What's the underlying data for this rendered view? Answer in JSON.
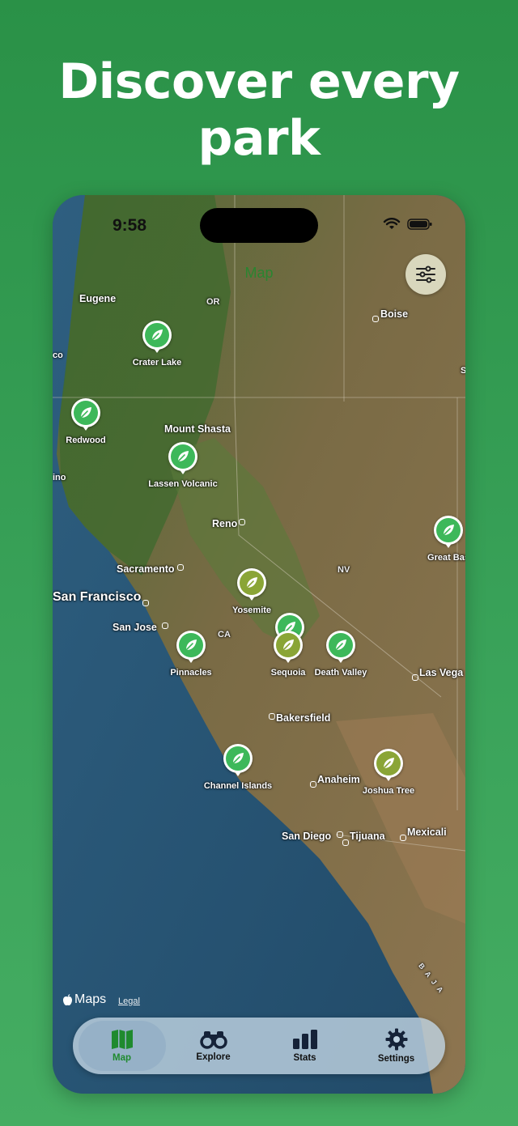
{
  "headline": "Discover every park",
  "status_bar": {
    "time": "9:58"
  },
  "nav": {
    "title": "Map",
    "filter_icon": "sliders-icon"
  },
  "map": {
    "attribution": "Maps",
    "legal": "Legal",
    "places": {
      "eugene": "Eugene",
      "or": "OR",
      "boise": "Boise",
      "co": "co",
      "mount_shasta": "Mount Shasta",
      "ino": "ino",
      "reno": "Reno",
      "sacramento": "Sacramento",
      "nv": "NV",
      "san_francisco": "San Francisco",
      "san_jose": "San Jose",
      "ca": "CA",
      "las_vegas": "Las Vega",
      "bakersfield": "Bakersfield",
      "anaheim": "Anaheim",
      "san_diego": "San Diego",
      "tijuana": "Tijuana",
      "mexicali": "Mexicali",
      "s_edge": "S",
      "baja": "B A J A"
    },
    "parks": [
      {
        "name": "Crater Lake",
        "visited": false
      },
      {
        "name": "Redwood",
        "visited": false
      },
      {
        "name": "Lassen Volcanic",
        "visited": false
      },
      {
        "name": "Great Bas",
        "visited": false
      },
      {
        "name": "Yosemite",
        "visited": true
      },
      {
        "name": "Pinnacles",
        "visited": false
      },
      {
        "name": "Sequoia",
        "visited": true
      },
      {
        "name": "Death Valley",
        "visited": false
      },
      {
        "name": "Channel Islands",
        "visited": false
      },
      {
        "name": "Joshua Tree",
        "visited": true
      }
    ],
    "colors": {
      "pin_unvisited": "#3db85a",
      "pin_visited": "#8aa536",
      "accent": "#1f8a2e"
    }
  },
  "tabs": [
    {
      "label": "Map",
      "icon": "map-icon",
      "active": true
    },
    {
      "label": "Explore",
      "icon": "binoculars-icon",
      "active": false
    },
    {
      "label": "Stats",
      "icon": "bar-chart-icon",
      "active": false
    },
    {
      "label": "Settings",
      "icon": "gear-icon",
      "active": false
    }
  ]
}
